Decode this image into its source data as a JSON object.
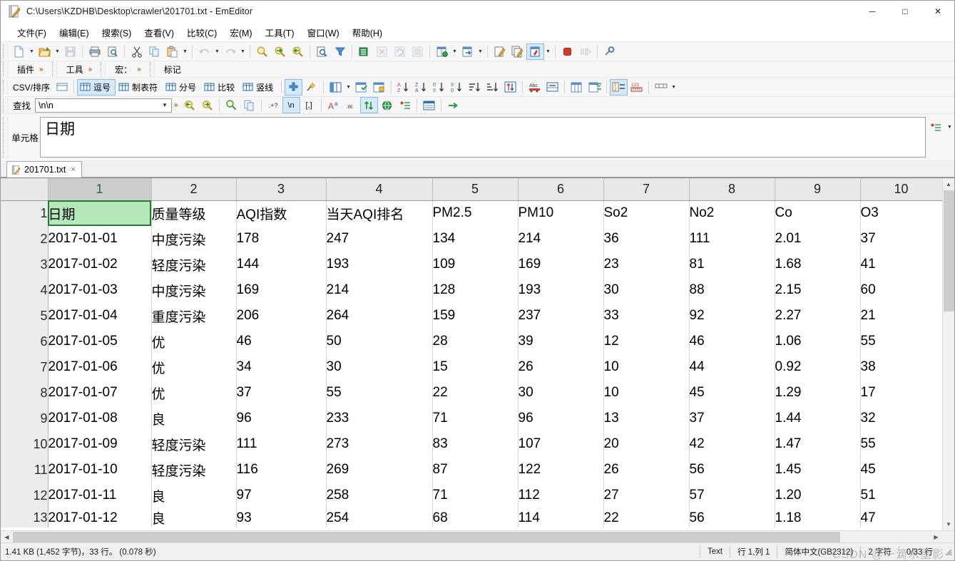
{
  "window": {
    "title": "C:\\Users\\KZDHB\\Desktop\\crawler\\201701.txt - EmEditor",
    "icon": "emeditor-document-icon",
    "minimize": "─",
    "maximize": "□",
    "close": "✕"
  },
  "menu": {
    "items": [
      {
        "label": "文件(F)",
        "name": "menu-file"
      },
      {
        "label": "编辑(E)",
        "name": "menu-edit"
      },
      {
        "label": "搜索(S)",
        "name": "menu-search"
      },
      {
        "label": "查看(V)",
        "name": "menu-view"
      },
      {
        "label": "比较(C)",
        "name": "menu-compare"
      },
      {
        "label": "宏(M)",
        "name": "menu-macro"
      },
      {
        "label": "工具(T)",
        "name": "menu-tools"
      },
      {
        "label": "窗口(W)",
        "name": "menu-window"
      },
      {
        "label": "帮助(H)",
        "name": "menu-help"
      }
    ]
  },
  "plugin_bar": {
    "items": [
      {
        "label": "插件",
        "name": "plugins-button",
        "chevron": "»"
      },
      {
        "label": "工具",
        "name": "tools-button",
        "chevron": "»"
      },
      {
        "label": "宏：",
        "name": "macro-button",
        "chevron": "»"
      },
      {
        "label": "标记",
        "name": "marker-button",
        "chevron": ""
      }
    ]
  },
  "csv_bar": {
    "title": "CSV/排序",
    "separators": [
      {
        "label": "逗号",
        "name": "csv-sep-comma",
        "active": true
      },
      {
        "label": "制表符",
        "name": "csv-sep-tab",
        "active": false
      },
      {
        "label": "分号",
        "name": "csv-sep-semicolon",
        "active": false
      },
      {
        "label": "比较",
        "name": "csv-sep-compare",
        "active": false
      },
      {
        "label": "竖线",
        "name": "csv-sep-vertical-bar",
        "active": false
      }
    ],
    "sort_icons": [
      "A↓Z",
      "Z↓A",
      "0↓9",
      "9↓0"
    ]
  },
  "find_bar": {
    "label": "查找",
    "value": "\\n\\n",
    "placeholder": "",
    "options": [
      ".+?",
      "\\n",
      "[,]",
      "Aa",
      ".w.",
      "↑↓"
    ]
  },
  "cell_panel": {
    "label": "单元格",
    "value": "日期"
  },
  "tabs": [
    {
      "label": "201701.txt",
      "icon": "emeditor-document-icon",
      "close": "×",
      "active": true
    }
  ],
  "grid": {
    "column_headers": [
      "1",
      "2",
      "3",
      "4",
      "5",
      "6",
      "7",
      "8",
      "9",
      "10"
    ],
    "selected_column_index": 0,
    "selected_cell": {
      "row": 1,
      "col": 1,
      "value": "日期",
      "highlight_color": "#b5e8b8"
    },
    "row_numbers": [
      "1",
      "2",
      "3",
      "4",
      "5",
      "6",
      "7",
      "8",
      "9",
      "10",
      "11",
      "12",
      "13"
    ],
    "rows": [
      [
        "日期",
        "质量等级",
        "AQI指数",
        "当天AQI排名",
        "PM2.5",
        "PM10",
        "So2",
        "No2",
        "Co",
        "O3"
      ],
      [
        "2017-01-01",
        "中度污染",
        "178",
        "247",
        "134",
        "214",
        "36",
        "111",
        "2.01",
        "37"
      ],
      [
        "2017-01-02",
        "轻度污染",
        "144",
        "193",
        "109",
        "169",
        "23",
        "81",
        "1.68",
        "41"
      ],
      [
        "2017-01-03",
        "中度污染",
        "169",
        "214",
        "128",
        "193",
        "30",
        "88",
        "2.15",
        "60"
      ],
      [
        "2017-01-04",
        "重度污染",
        "206",
        "264",
        "159",
        "237",
        "33",
        "92",
        "2.27",
        "21"
      ],
      [
        "2017-01-05",
        "优",
        "46",
        "50",
        "28",
        "39",
        "12",
        "46",
        "1.06",
        "55"
      ],
      [
        "2017-01-06",
        "优",
        "34",
        "30",
        "15",
        "26",
        "10",
        "44",
        "0.92",
        "38"
      ],
      [
        "2017-01-07",
        "优",
        "37",
        "55",
        "22",
        "30",
        "10",
        "45",
        "1.29",
        "17"
      ],
      [
        "2017-01-08",
        "良",
        "96",
        "233",
        "71",
        "96",
        "13",
        "37",
        "1.44",
        "32"
      ],
      [
        "2017-01-09",
        "轻度污染",
        "111",
        "273",
        "83",
        "107",
        "20",
        "42",
        "1.47",
        "55"
      ],
      [
        "2017-01-10",
        "轻度污染",
        "116",
        "269",
        "87",
        "122",
        "26",
        "56",
        "1.45",
        "45"
      ],
      [
        "2017-01-11",
        "良",
        "97",
        "258",
        "71",
        "112",
        "27",
        "57",
        "1.20",
        "51"
      ],
      [
        "2017-01-12",
        "良",
        "93",
        "254",
        "68",
        "114",
        "22",
        "56",
        "1.18",
        "47"
      ]
    ]
  },
  "status_bar": {
    "left": "1.41 KB (1,452 字节)，33 行。 (0.078 秒)",
    "mode": "Text",
    "position": "行 1,列 1",
    "encoding": "简体中文(GB2312)",
    "chars": "2 字符",
    "lines": "0/33 行"
  },
  "watermark": "CSDN @一滴水墨影"
}
